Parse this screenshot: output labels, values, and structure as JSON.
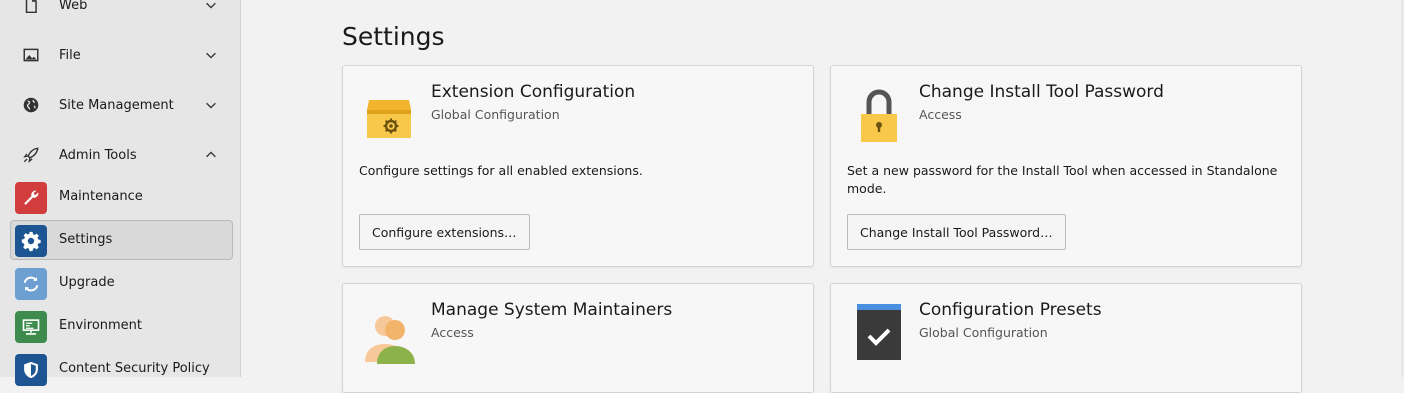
{
  "sidebar": {
    "groups": [
      {
        "label": "Web",
        "icon": "page-icon"
      },
      {
        "label": "File",
        "icon": "image-icon"
      },
      {
        "label": "Site Management",
        "icon": "globe-icon"
      },
      {
        "label": "Admin Tools",
        "icon": "rocket-icon"
      }
    ],
    "modules": [
      {
        "label": "Maintenance",
        "icon": "wrench-icon",
        "color": "#d13d3d"
      },
      {
        "label": "Settings",
        "icon": "gear-icon",
        "color": "#1c5592",
        "active": true
      },
      {
        "label": "Upgrade",
        "icon": "refresh-icon",
        "color": "#6d9fd1"
      },
      {
        "label": "Environment",
        "icon": "server-icon",
        "color": "#3d8c4e"
      },
      {
        "label": "Content Security Policy",
        "icon": "shield-icon",
        "color": "#1c5592"
      }
    ]
  },
  "main": {
    "title": "Settings",
    "cards": [
      {
        "title": "Extension Configuration",
        "subtitle": "Global Configuration",
        "description": "Configure settings for all enabled extensions.",
        "button": "Configure extensions…",
        "icon": "extension-box-icon"
      },
      {
        "title": "Change Install Tool Password",
        "subtitle": "Access",
        "description": "Set a new password for the Install Tool when accessed in Standalone mode.",
        "button": "Change Install Tool Password…",
        "icon": "lock-icon"
      },
      {
        "title": "Manage System Maintainers",
        "subtitle": "Access",
        "icon": "users-icon"
      },
      {
        "title": "Configuration Presets",
        "subtitle": "Global Configuration",
        "icon": "checkbox-icon"
      }
    ]
  }
}
